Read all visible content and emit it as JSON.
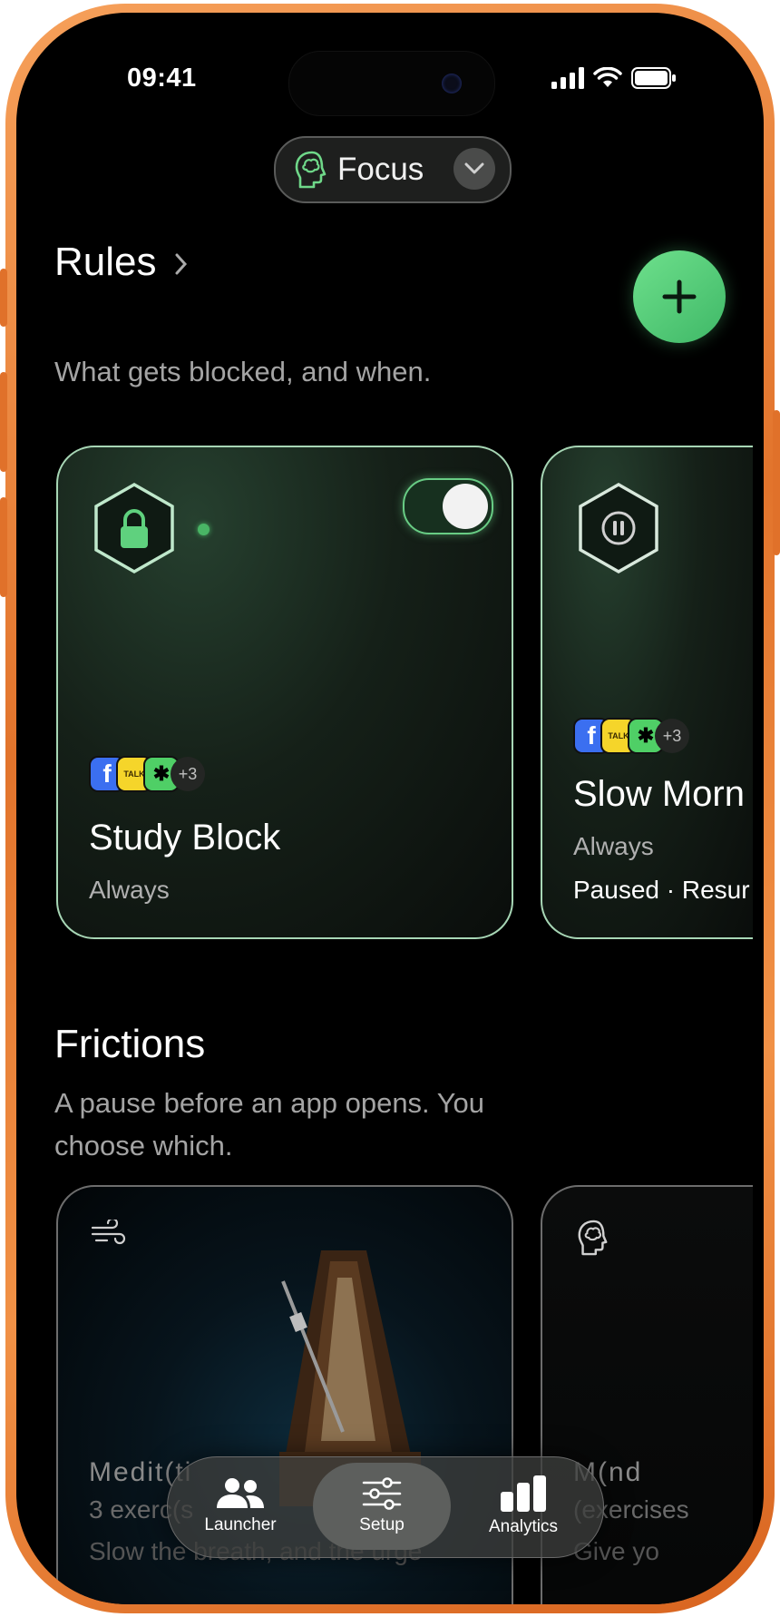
{
  "status_bar": {
    "time": "09:41"
  },
  "focus_selector": {
    "label": "Focus",
    "icon": "brain-head-icon"
  },
  "rules": {
    "title": "Rules",
    "subtitle": "What gets blocked, and when.",
    "add_icon": "plus-icon",
    "cards": [
      {
        "name": "Study Block",
        "schedule": "Always",
        "status": "",
        "state_icon": "lock-icon",
        "enabled": true,
        "apps": [
          "f",
          "TALK",
          "✱"
        ],
        "more": "+3"
      },
      {
        "name": "Slow Morn",
        "schedule": "Always",
        "status": "Paused · Resur",
        "state_icon": "pause-icon",
        "enabled": false,
        "apps": [
          "f",
          "TALK",
          "✱"
        ],
        "more": "+3"
      }
    ]
  },
  "frictions": {
    "title": "Frictions",
    "subtitle_line1": "A pause before an app opens. You",
    "subtitle_line2": "choose which.",
    "cards": [
      {
        "name": "Medit(ti",
        "count": "3 exerc(s",
        "desc": "Slow the breath, and the urge",
        "icon": "wind-icon"
      },
      {
        "name": "M(nd",
        "count": "(exercises",
        "desc": "Give yo",
        "icon": "brain-head-icon"
      }
    ]
  },
  "tab_bar": {
    "items": [
      {
        "label": "Launcher",
        "icon": "people-icon",
        "active": false
      },
      {
        "label": "Setup",
        "icon": "sliders-icon",
        "active": true
      },
      {
        "label": "Analytics",
        "icon": "bar-chart-icon",
        "active": false
      }
    ]
  },
  "colors": {
    "accent": "#5fd17e",
    "card_border": "#a7d6b5",
    "background": "#000000"
  }
}
